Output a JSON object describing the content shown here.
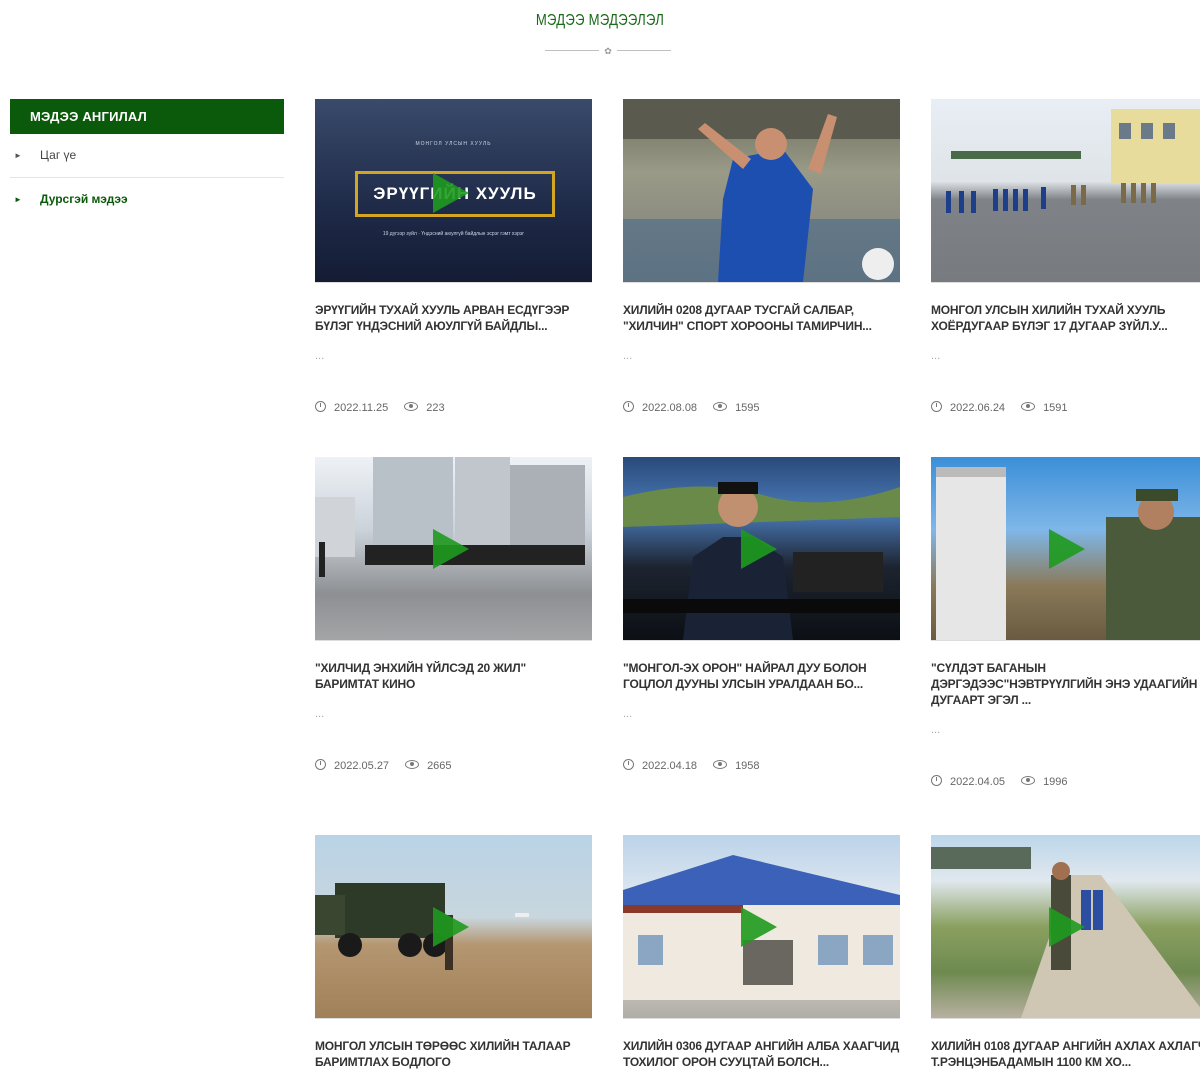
{
  "header": {
    "title": "МЭДЭЭ МЭДЭЭЛЭЛ"
  },
  "sidebar": {
    "title": "МЭДЭЭ АНГИЛАЛ",
    "items": [
      {
        "label": "Цаг үе",
        "active": false
      },
      {
        "label": "Дурсгэй мэдээ",
        "active": true
      }
    ]
  },
  "articles": [
    {
      "title": "ЭРҮҮГИЙН ТУХАЙ ХУУЛЬ АРВАН ЕСДҮГЭЭР БҮЛЭГ ҮНДЭСНИЙ АЮУЛГҮЙ БАЙДЛЫ...",
      "dash": "...",
      "date": "2022.11.25",
      "views": "223",
      "overlay_top": "МОНГОЛ УЛСЫН ХУУЛЬ",
      "overlay_main": "ЭРҮҮГИЙН ХУУЛЬ",
      "overlay_bottom": "19 дүгээр зүйл · Үндэсний аюулгүй байдлын эсрэг гэмт хэрэг"
    },
    {
      "title": "ХИЛИЙН 0208 ДУГААР ТУСГАЙ САЛБАР, \"ХИЛЧИН\" СПОРТ ХОРООНЫ ТАМИРЧИН...",
      "dash": "...",
      "date": "2022.08.08",
      "views": "1595"
    },
    {
      "title": "МОНГОЛ УЛСЫН ХИЛИЙН ТУХАЙ ХУУЛЬ ХОЁРДУГААР БҮЛЭГ 17 ДУГААР ЗҮЙЛ.У...",
      "dash": "...",
      "date": "2022.06.24",
      "views": "1591"
    },
    {
      "title": "\"ХИЛЧИД ЭНХИЙН ҮЙЛСЭД 20 ЖИЛ\" БАРИМТАТ КИНО",
      "dash": "...",
      "date": "2022.05.27",
      "views": "2665"
    },
    {
      "title": "\"МОНГОЛ-ЭХ ОРОН\" НАЙРАЛ ДУУ БОЛОН ГОЦЛОЛ ДУУНЫ УЛСЫН УРАЛДААН БО...",
      "dash": "...",
      "date": "2022.04.18",
      "views": "1958"
    },
    {
      "title": "\"СҮЛДЭТ БАГАНЫН ДЭРГЭДЭЭС\"НЭВТРҮҮЛГИЙН ЭНЭ УДААГИЙН ДУГААРТ ЭГЭЛ ...",
      "dash": "...",
      "date": "2022.04.05",
      "views": "1996"
    },
    {
      "title": "МОНГОЛ УЛСЫН ТӨРӨӨС ХИЛИЙН ТАЛААР БАРИМТЛАХ БОДЛОГО",
      "dash": "",
      "date": "",
      "views": ""
    },
    {
      "title": "ХИЛИЙН 0306 ДУГААР АНГИЙН АЛБА ХААГЧИД ТОХИЛОГ ОРОН СУУЦТАЙ БОЛСН...",
      "dash": "",
      "date": "",
      "views": ""
    },
    {
      "title": "ХИЛИЙН 0108 ДУГААР АНГИЙН АХЛАХ АХЛАГЧ Т.РЭНЦЭНБАДАМЫН 1100 КМ ХО...",
      "dash": "",
      "date": "",
      "views": ""
    }
  ],
  "icons": {
    "date": "clock-icon",
    "views": "eye-icon",
    "bullet": "triangle-right-icon",
    "play": "play-icon"
  },
  "colors": {
    "brand": "#0b5a0b",
    "play": "#1e9a1e",
    "title_text": "#1a6a1a"
  }
}
